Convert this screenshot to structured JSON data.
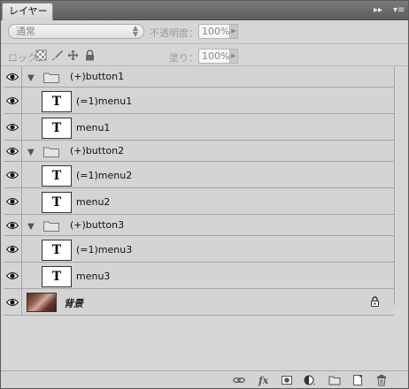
{
  "panel": {
    "tab_label": "レイヤー",
    "expand_glyph": "▸▸",
    "menu_glyph": "▾≡"
  },
  "options": {
    "blend_mode": "通常",
    "opacity_label": "不透明度：",
    "opacity_value": "100%",
    "lock_label": "ロック：",
    "fill_label": "塗り：",
    "fill_value": "100%"
  },
  "layers": [
    {
      "type": "group",
      "name": "(+)button1"
    },
    {
      "type": "text",
      "name": "(=1)menu1"
    },
    {
      "type": "text",
      "name": "menu1"
    },
    {
      "type": "group",
      "name": "(+)button2"
    },
    {
      "type": "text",
      "name": "(=1)menu2"
    },
    {
      "type": "text",
      "name": "menu2"
    },
    {
      "type": "group",
      "name": "(+)button3"
    },
    {
      "type": "text",
      "name": "(=1)menu3"
    },
    {
      "type": "text",
      "name": "menu3"
    },
    {
      "type": "background",
      "name": "背景"
    }
  ],
  "text_thumb_glyph": "T",
  "group_toggle_glyph": "▼",
  "icons": {
    "eye": "eye-icon",
    "folder": "folder-icon",
    "lock": "padlock-icon",
    "bottom": [
      "link-icon",
      "fx-icon",
      "mask-icon",
      "adjustment-icon",
      "new-group-icon",
      "new-layer-icon",
      "trash-icon"
    ]
  }
}
